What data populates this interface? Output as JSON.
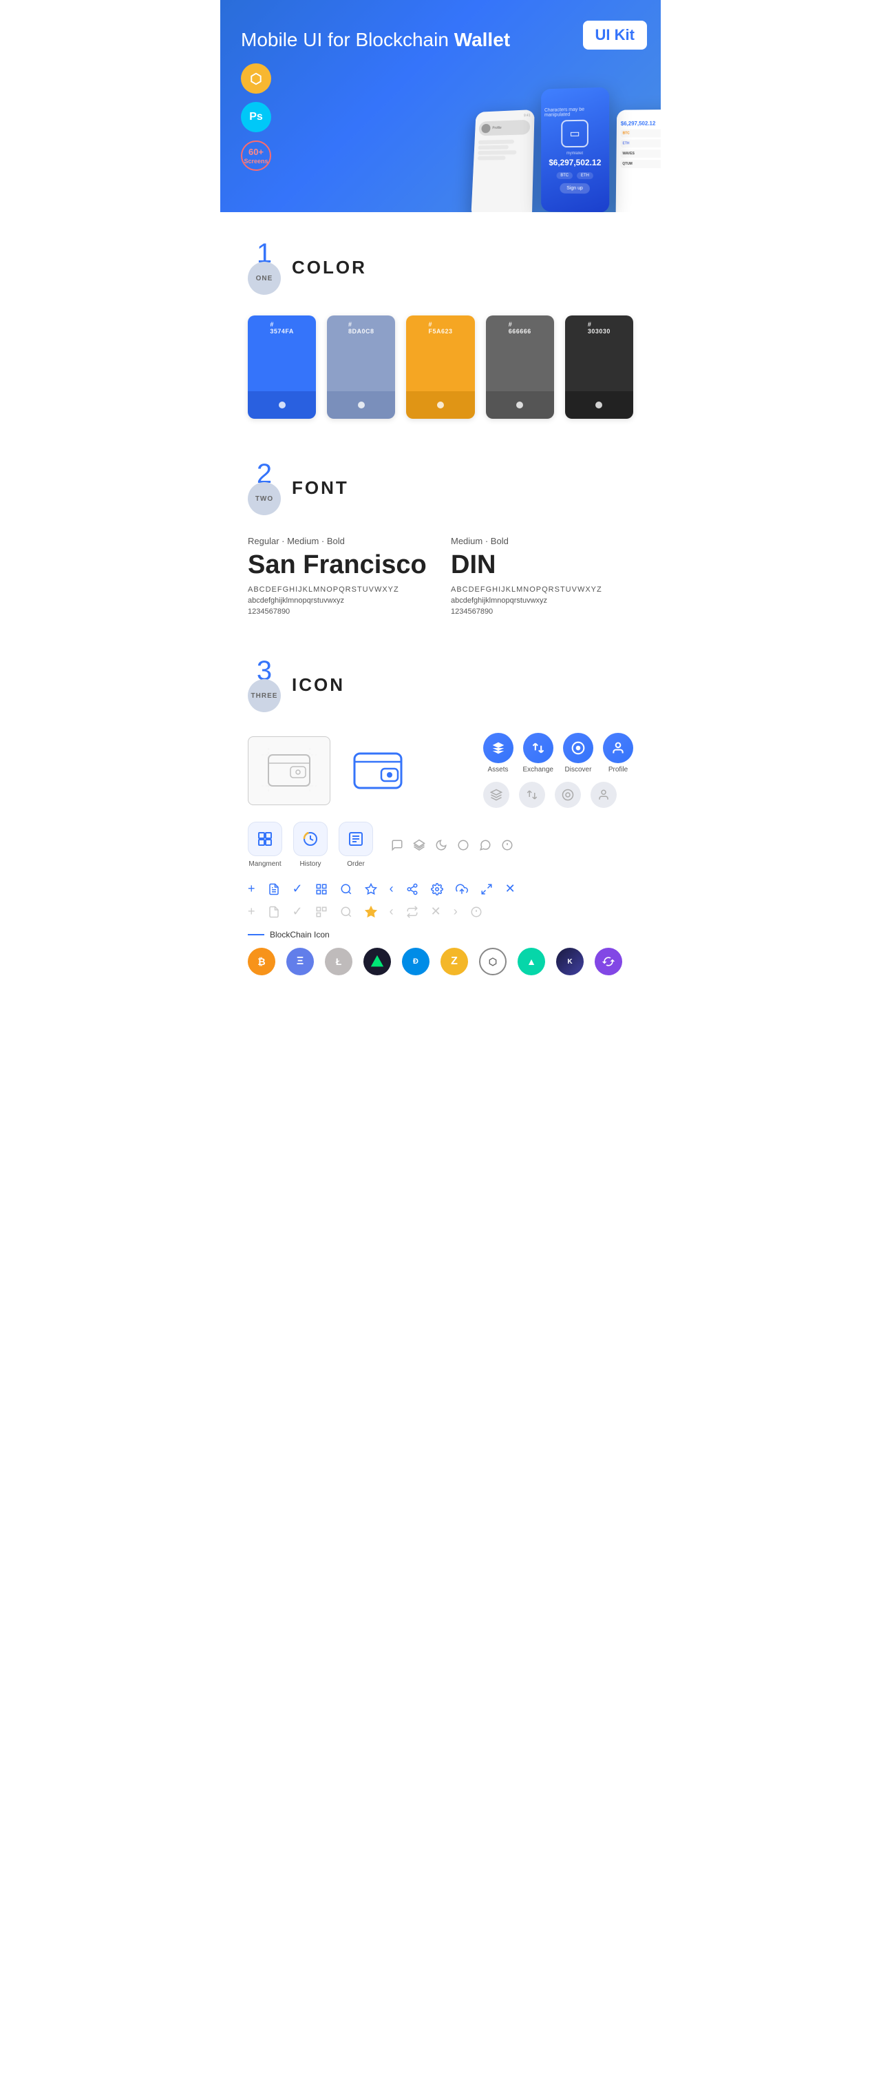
{
  "hero": {
    "title_regular": "Mobile UI for Blockchain ",
    "title_bold": "Wallet",
    "badge": "UI Kit",
    "badges": [
      {
        "id": "sketch",
        "label": "Sketch",
        "symbol": "⬡"
      },
      {
        "id": "ps",
        "label": "Ps"
      },
      {
        "id": "screens",
        "line1": "60+",
        "line2": "Screens"
      }
    ]
  },
  "sections": {
    "color": {
      "number": "1",
      "number_label": "ONE",
      "title": "COLOR",
      "swatches": [
        {
          "id": "blue",
          "hex": "#3574FA",
          "display": "#\n3574FA",
          "bg": "#3574FA",
          "bottom_bg": "#2960e0"
        },
        {
          "id": "slate",
          "hex": "#8DA0C8",
          "display": "#\n8DA0C8",
          "bg": "#8DA0C8",
          "bottom_bg": "#7a8fbb"
        },
        {
          "id": "orange",
          "hex": "#F5A623",
          "display": "#\nF5A623",
          "bg": "#F5A623",
          "bottom_bg": "#e09515"
        },
        {
          "id": "gray",
          "hex": "#666666",
          "display": "#\n666666",
          "bg": "#666666",
          "bottom_bg": "#555"
        },
        {
          "id": "dark",
          "hex": "#303030",
          "display": "#\n303030",
          "bg": "#303030",
          "bottom_bg": "#222"
        }
      ]
    },
    "font": {
      "number": "2",
      "number_label": "TWO",
      "title": "FONT",
      "fonts": [
        {
          "weights": "Regular · Medium · Bold",
          "name": "San Francisco",
          "uppercase": "ABCDEFGHIJKLMNOPQRSTUVWXYZ",
          "lowercase": "abcdefghijklmnopqrstuvwxyz",
          "numbers": "1234567890"
        },
        {
          "weights": "Medium · Bold",
          "name": "DIN",
          "uppercase": "ABCDEFGHIJKLMNOPQRSTUVWXYZ",
          "lowercase": "abcdefghijklmnopqrstuvwxyz",
          "numbers": "1234567890"
        }
      ]
    },
    "icon": {
      "number": "3",
      "number_label": "THREE",
      "title": "ICON",
      "nav_icons": [
        {
          "label": "Assets",
          "symbol": "◆",
          "colored": true
        },
        {
          "label": "Exchange",
          "symbol": "⇄",
          "colored": true
        },
        {
          "label": "Discover",
          "symbol": "◉",
          "colored": true
        },
        {
          "label": "Profile",
          "symbol": "☻",
          "colored": true
        }
      ],
      "nav_icons_gray": [
        {
          "symbol": "◆"
        },
        {
          "symbol": "⇄"
        },
        {
          "symbol": "◉"
        },
        {
          "symbol": "☻"
        }
      ],
      "bottom_icons": [
        {
          "label": "Mangment",
          "symbol": "▦"
        },
        {
          "label": "History",
          "symbol": "◷"
        },
        {
          "label": "Order",
          "symbol": "≡"
        }
      ],
      "small_icons_row1": [
        "+",
        "⊞",
        "✓",
        "⊟",
        "⌕",
        "☆",
        "‹",
        "⇤",
        "⚙",
        "⊡",
        "⇔",
        "✕"
      ],
      "small_icons_row2": [
        "+",
        "⊞",
        "✓",
        "⊟",
        "⌕",
        "☆",
        "‹",
        "⇤",
        "⊡",
        "⇔",
        "ⓘ"
      ],
      "blockchain_label": "BlockChain Icon",
      "coins": [
        {
          "id": "btc",
          "symbol": "₿",
          "class": "coin-btc"
        },
        {
          "id": "eth",
          "symbol": "Ξ",
          "class": "coin-eth"
        },
        {
          "id": "ltc",
          "symbol": "Ł",
          "class": "coin-ltc"
        },
        {
          "id": "neo",
          "symbol": "▶",
          "class": "coin-neo"
        },
        {
          "id": "dash",
          "symbol": "Đ",
          "class": "coin-dash"
        },
        {
          "id": "zcash",
          "symbol": "ⓩ",
          "class": "coin-zcash"
        },
        {
          "id": "grid",
          "symbol": "⬡",
          "class": "coin-grid"
        },
        {
          "id": "steem",
          "symbol": "▲",
          "class": "coin-steem"
        },
        {
          "id": "kyber",
          "symbol": "◇",
          "class": "coin-kyber"
        },
        {
          "id": "matic",
          "symbol": "⬟",
          "class": "coin-matic"
        }
      ]
    }
  }
}
